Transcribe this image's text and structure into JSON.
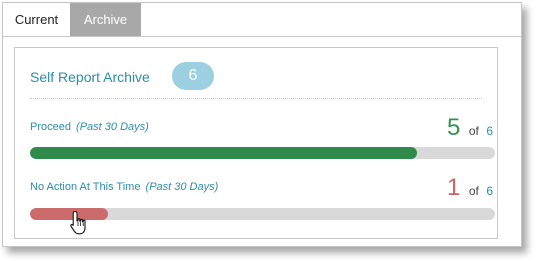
{
  "tabs": [
    {
      "label": "Current",
      "active": false
    },
    {
      "label": "Archive",
      "active": true
    }
  ],
  "card": {
    "title": "Self Report Archive",
    "count": "6"
  },
  "metrics": [
    {
      "label": "Proceed",
      "period": "(Past 30 Days)",
      "value": "5",
      "of_text": "of",
      "total": "6",
      "fraction": 0.833,
      "color": "#2f8a4c"
    },
    {
      "label": "No Action At This Time",
      "period": "(Past 30 Days)",
      "value": "1",
      "of_text": "of",
      "total": "6",
      "fraction": 0.167,
      "color": "#cc6b6b"
    }
  ],
  "icons": {
    "cursor": "hand-pointer-icon"
  }
}
